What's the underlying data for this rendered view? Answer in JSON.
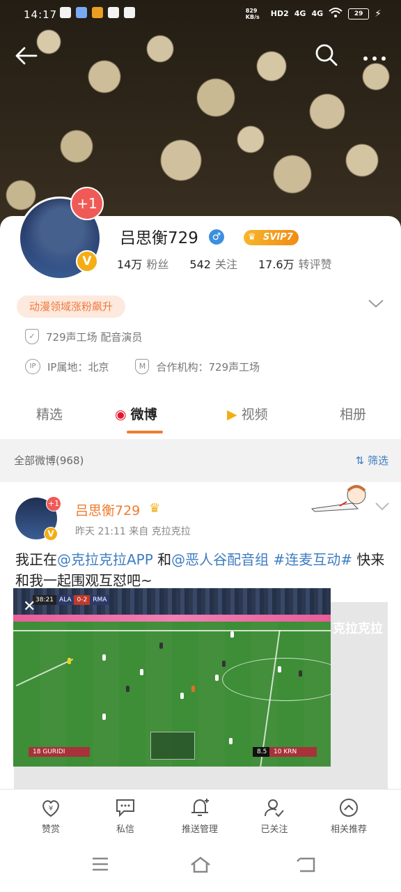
{
  "status_bar": {
    "time": "14:17",
    "net_speed": "829 KB/s",
    "hd": "HD2",
    "sig1": "4G",
    "sig2": "4G",
    "battery": "29"
  },
  "profile": {
    "avatar_badge": "+1",
    "verified_mark": "V",
    "name": "吕思衡729",
    "gender_symbol": "♂",
    "vip": "SVIP7",
    "stats": [
      {
        "value": "14万",
        "label": "粉丝"
      },
      {
        "value": "542",
        "label": "关注"
      },
      {
        "value": "17.6万",
        "label": "转评赞"
      }
    ],
    "tag": "动漫领域涨粉飙升",
    "verified_info": "729声工场 配音演员",
    "ip_label": "IP属地：北京",
    "agency_label": "合作机构：729声工场",
    "ip_icon_text": "IP",
    "agency_icon_text": "M"
  },
  "tabs": [
    {
      "label": "精选"
    },
    {
      "label": "微博"
    },
    {
      "label": "视频"
    },
    {
      "label": "相册"
    }
  ],
  "filter": {
    "all_label": "全部微博(968)",
    "filter_label": "筛选"
  },
  "post": {
    "author": "吕思衡729",
    "avatar_badge": "+1",
    "time_source": "昨天 21:11  来自 克拉克拉",
    "text_1": "我正在",
    "link_1": "@克拉克拉APP",
    "text_2": " 和",
    "link_2": "@恶人谷配音组",
    "text_3": " ",
    "link_3": "#连麦互动#",
    "text_4": " 快来和我一起围观互怼吧~",
    "ghost_text": "克拉克拉",
    "video": {
      "clock": "38:21",
      "team_home": "ALA",
      "score": "0-2",
      "team_away": "RMA",
      "hud_left": "18 GURIDI",
      "hud_right_score": "8.5",
      "hud_right": "10 KRN"
    }
  },
  "actions": [
    {
      "label": "赞赏",
      "icon": "heart-yen-icon"
    },
    {
      "label": "私信",
      "icon": "chat-icon"
    },
    {
      "label": "推送管理",
      "icon": "bell-plus-icon"
    },
    {
      "label": "已关注",
      "icon": "user-check-icon"
    },
    {
      "label": "相关推荐",
      "icon": "chevron-up-circle-icon"
    }
  ]
}
